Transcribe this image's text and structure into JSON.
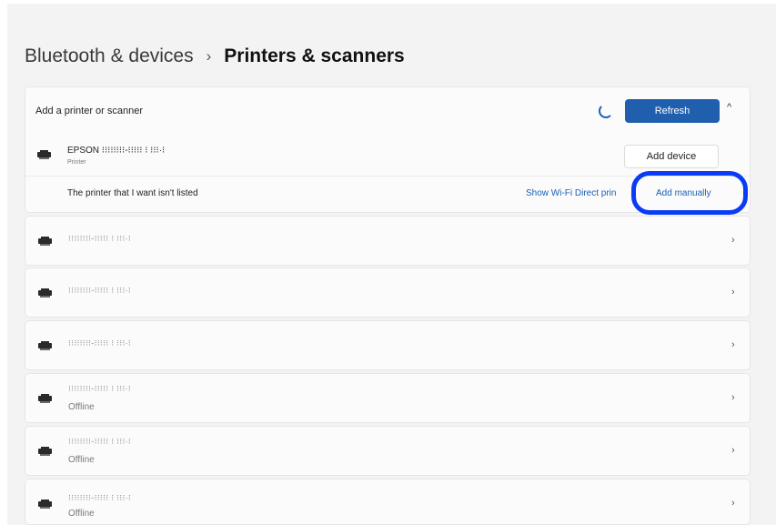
{
  "breadcrumb": {
    "parent": "Bluetooth & devices",
    "separator": "›",
    "current": "Printers & scanners"
  },
  "add_panel": {
    "title": "Add a printer or scanner",
    "refresh_label": "Refresh",
    "collapse_icon": "^",
    "epson": {
      "name": "EPSON ⁝⁝⁝⁝⁝⁝⁝⁝-⁝⁝⁝⁝⁝ ⁝ ⁝⁝⁝·⁝",
      "type": "Printer",
      "add_device_label": "Add device"
    },
    "not_listed": {
      "label": "The printer that I want isn't listed",
      "wifi_direct_label": "Show Wi-Fi Direct prin",
      "add_manually_label": "Add manually"
    }
  },
  "printers": [
    {
      "name": "⁝⁝⁝⁝⁝⁝⁝⁝-⁝⁝⁝⁝⁝ ⁝ ⁝⁝⁝·⁝",
      "status": "",
      "chevron": "›"
    },
    {
      "name": "⁝⁝⁝⁝⁝⁝⁝⁝-⁝⁝⁝⁝⁝ ⁝ ⁝⁝⁝·⁝",
      "status": "",
      "chevron": "›"
    },
    {
      "name": "⁝⁝⁝⁝⁝⁝⁝⁝-⁝⁝⁝⁝⁝ ⁝ ⁝⁝⁝·⁝",
      "status": "",
      "chevron": "›"
    },
    {
      "name": "⁝⁝⁝⁝⁝⁝⁝⁝-⁝⁝⁝⁝⁝ ⁝ ⁝⁝⁝·⁝",
      "status": "Offline",
      "chevron": "›"
    },
    {
      "name": "⁝⁝⁝⁝⁝⁝⁝⁝-⁝⁝⁝⁝⁝ ⁝ ⁝⁝⁝·⁝",
      "status": "Offline",
      "chevron": "›"
    },
    {
      "name": "⁝⁝⁝⁝⁝⁝⁝⁝-⁝⁝⁝⁝⁝ ⁝ ⁝⁝⁝·⁝",
      "status": "Offline",
      "chevron": "›"
    }
  ],
  "colors": {
    "accent": "#1f5fae",
    "link": "#1a5fb4",
    "highlight_ring": "#0a3cf5",
    "page_background": "#f3f3f3"
  }
}
